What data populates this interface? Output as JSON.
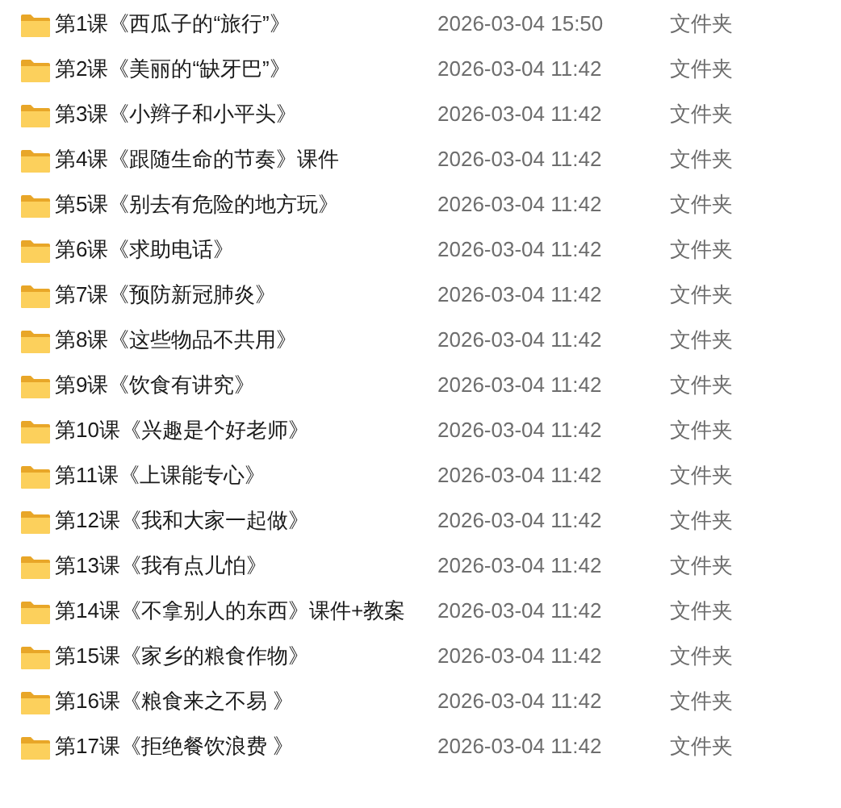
{
  "files": [
    {
      "name": "第1课《西瓜子的“旅行”》",
      "modified": "2026-03-04 15:50",
      "type": "文件夹"
    },
    {
      "name": "第2课《美丽的“缺牙巴”》",
      "modified": "2026-03-04 11:42",
      "type": "文件夹"
    },
    {
      "name": "第3课《小辫子和小平头》",
      "modified": "2026-03-04 11:42",
      "type": "文件夹"
    },
    {
      "name": "第4课《跟随生命的节奏》课件",
      "modified": "2026-03-04 11:42",
      "type": "文件夹"
    },
    {
      "name": "第5课《别去有危险的地方玩》",
      "modified": "2026-03-04 11:42",
      "type": "文件夹"
    },
    {
      "name": "第6课《求助电话》",
      "modified": "2026-03-04 11:42",
      "type": "文件夹"
    },
    {
      "name": "第7课《预防新冠肺炎》",
      "modified": "2026-03-04 11:42",
      "type": "文件夹"
    },
    {
      "name": "第8课《这些物品不共用》",
      "modified": "2026-03-04 11:42",
      "type": "文件夹"
    },
    {
      "name": "第9课《饮食有讲究》",
      "modified": "2026-03-04 11:42",
      "type": "文件夹"
    },
    {
      "name": "第10课《兴趣是个好老师》",
      "modified": "2026-03-04 11:42",
      "type": "文件夹"
    },
    {
      "name": "第11课《上课能专心》",
      "modified": "2026-03-04 11:42",
      "type": "文件夹"
    },
    {
      "name": "第12课《我和大家一起做》",
      "modified": "2026-03-04 11:42",
      "type": "文件夹"
    },
    {
      "name": "第13课《我有点儿怕》",
      "modified": "2026-03-04 11:42",
      "type": "文件夹"
    },
    {
      "name": "第14课《不拿别人的东西》课件+教案",
      "modified": "2026-03-04 11:42",
      "type": "文件夹"
    },
    {
      "name": "第15课《家乡的粮食作物》",
      "modified": "2026-03-04 11:42",
      "type": "文件夹"
    },
    {
      "name": "第16课《粮食来之不易 》",
      "modified": "2026-03-04 11:42",
      "type": "文件夹"
    },
    {
      "name": "第17课《拒绝餐饮浪费 》",
      "modified": "2026-03-04 11:42",
      "type": "文件夹"
    }
  ]
}
